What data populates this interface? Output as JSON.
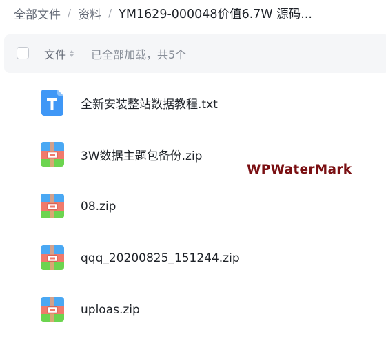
{
  "breadcrumb": {
    "items": [
      "全部文件",
      "资料"
    ],
    "separator": "/",
    "current": "YM1629-000048价值6.7W 源码..."
  },
  "header": {
    "column_file": "文件",
    "load_status": "已全部加载，共5个"
  },
  "files": [
    {
      "name": "全新安装整站数据教程.txt",
      "icon": "txt-file-icon"
    },
    {
      "name": "3W数据主题包备份.zip",
      "icon": "zip-file-icon"
    },
    {
      "name": "08.zip",
      "icon": "zip-file-icon"
    },
    {
      "name": "qqq_20200825_151244.zip",
      "icon": "zip-file-icon"
    },
    {
      "name": "uploas.zip",
      "icon": "zip-file-icon"
    }
  ],
  "watermark": "WPWaterMark",
  "colors": {
    "txt_icon": "#3f97f6",
    "zip_top": "#4aa8f3",
    "zip_middle": "#f07a6c",
    "zip_bottom": "#6cd44f",
    "zip_buckle": "#ffffff",
    "watermark": "#7a0f12"
  }
}
